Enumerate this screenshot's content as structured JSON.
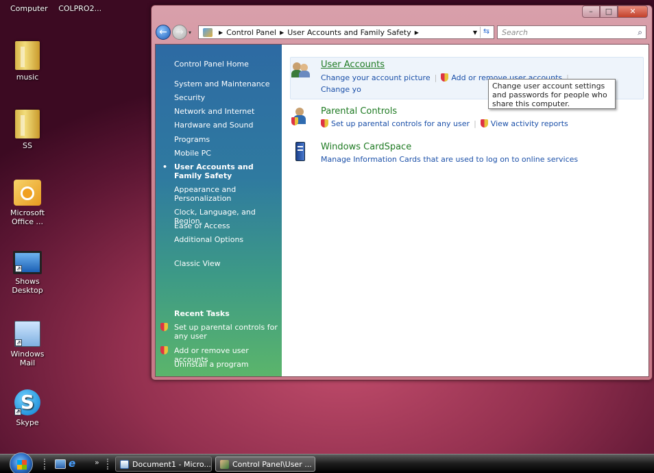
{
  "desktop": {
    "top_labels": [
      "Computer",
      "COLPRO2..."
    ],
    "icons": [
      {
        "label": "music",
        "icon": "folder-icon"
      },
      {
        "label": "SS",
        "icon": "folder-icon"
      },
      {
        "label": "Microsoft Office ...",
        "icon": "outlook-icon"
      },
      {
        "label": "Shows Desktop",
        "icon": "monitor-icon"
      },
      {
        "label": "Windows Mail",
        "icon": "mail-icon"
      },
      {
        "label": "Skype",
        "icon": "skype-icon"
      }
    ]
  },
  "window": {
    "controls": {
      "minimize": "–",
      "maximize": "□",
      "close": "✕"
    },
    "address": {
      "crumbs": [
        "Control Panel",
        "User Accounts and Family Safety"
      ]
    },
    "search": {
      "placeholder": "Search"
    },
    "sidebar": {
      "items": [
        "Control Panel Home",
        "System and Maintenance",
        "Security",
        "Network and Internet",
        "Hardware and Sound",
        "Programs",
        "Mobile PC",
        "User Accounts and Family Safety",
        "Appearance and Personalization",
        "Clock, Language, and Region",
        "Ease of Access",
        "Additional Options",
        "Classic View"
      ],
      "selected": "User Accounts and Family Safety",
      "recent_title": "Recent Tasks",
      "recent": [
        "Set up parental controls for any user",
        "Add or remove user accounts",
        "Uninstall a program"
      ]
    },
    "categories": [
      {
        "title": "User Accounts",
        "links": [
          "Change your account picture",
          "Add or remove user accounts",
          "Change yo"
        ]
      },
      {
        "title": "Parental Controls",
        "links": [
          "Set up parental controls for any user",
          "View activity reports"
        ]
      },
      {
        "title": "Windows CardSpace",
        "links": [
          "Manage Information Cards that are used to log on to online services"
        ]
      }
    ],
    "tooltip": "Change user account settings and passwords for people who share this computer."
  },
  "taskbar": {
    "buttons": [
      {
        "label": "Document1 - Micro...",
        "active": false
      },
      {
        "label": "Control Panel\\User ...",
        "active": true
      }
    ],
    "overflow": "»"
  },
  "colors": {
    "link": "#1a4fa8",
    "category_title": "#1e7a22",
    "sidebar_top": "#2d6aa3",
    "sidebar_bottom": "#5bb56b"
  }
}
